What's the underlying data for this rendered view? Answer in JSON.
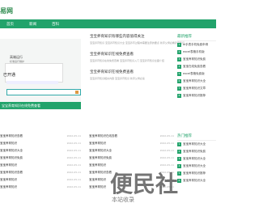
{
  "logo": "易网",
  "nav": [
    "首页",
    "新闻",
    "百科"
  ],
  "slide": {
    "title": "高端运行",
    "subtitle": "标准运行维护",
    "state": "已开通",
    "caption": "宝宝养育知识在线免费查看"
  },
  "articles": [
    {
      "title": "宝宝养育知识有哪些内容值得关注",
      "text": "宝宝养育知识 宝宝养育知识大全 宝宝养育过程中需要注意的要点 新手父母必看养育知识"
    },
    {
      "title": "宝宝养育知识在线免费查看",
      "text": "宝宝养育知识在线免费查看 宝宝养育知识入门 宝宝养育知识全面介绍"
    },
    {
      "title": "宝宝养育知识在线免费查看",
      "text": "宝宝养育知识相关内容 宝宝养育知识 新手父母必读"
    }
  ],
  "recommend": {
    "heading": "最新推荐",
    "items": [
      "ai手表手机免费申请",
      "excel表格手机版",
      "宝宝养育知识免费",
      "宝宝在线免费查看",
      "excel表格免费版",
      "宝宝养育知识大全",
      "宝宝养育知识文章",
      "宝宝养育知识推荐"
    ]
  },
  "hot": {
    "heading": "热门推荐",
    "items": [
      "宝宝养育知识大全",
      "宝宝养育知识免费",
      "宝宝养育知识大全",
      "宝宝养育知识大全",
      "宝宝养育知识推荐",
      "宝宝养育知识大全"
    ]
  },
  "left_list": [
    {
      "t": "宝宝养育知识查看",
      "d": "2022-05-11"
    },
    {
      "t": "宝宝养育知识",
      "d": "2022-05-11"
    },
    {
      "t": "宝宝养育知识大全",
      "d": "2022-05-11"
    },
    {
      "t": "宝宝养育知识免费",
      "d": "2022-05-11"
    },
    {
      "t": "宝宝养育知识",
      "d": "2022-05-11"
    },
    {
      "t": "宝宝养育知识查看",
      "d": "2022-05-11"
    },
    {
      "t": "宝宝养育知识",
      "d": "2022-05-11"
    },
    {
      "t": "宝宝养育知识",
      "d": "2022-05-11"
    }
  ],
  "mid_list": [
    {
      "t": "宝宝养育知识在线查看",
      "d": "2022-05-11"
    },
    {
      "t": "宝宝养育知识",
      "d": "2022-05-11"
    },
    {
      "t": "宝宝养育知识大全",
      "d": "2022-05-11"
    },
    {
      "t": "宝宝养育知识免费",
      "d": "2022-05-11"
    },
    {
      "t": "宝宝养育知识",
      "d": "2022-05-11"
    },
    {
      "t": "宝宝养育知识查看",
      "d": "2022-05-11"
    },
    {
      "t": "宝宝养育知识",
      "d": "2022-05-11"
    },
    {
      "t": "宝宝养育知识",
      "d": "2022-05-11"
    }
  ],
  "watermark": {
    "text": "便民社",
    "sub": "本站收录"
  }
}
